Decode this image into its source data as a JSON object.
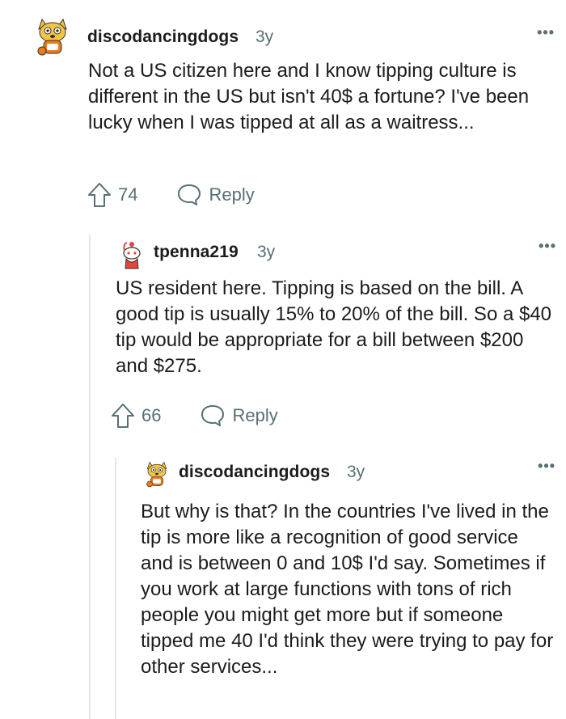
{
  "comments": [
    {
      "username": "discodancingdogs",
      "age": "3y",
      "more": "•••",
      "body": "Not a US citizen here and I know tipping culture is different in the US but isn't 40$ a fortune? I've been lucky when I was tipped at all as a waitress...",
      "votes": "74",
      "reply_label": "Reply"
    },
    {
      "username": "tpenna219",
      "age": "3y",
      "more": "•••",
      "body": "US resident here. Tipping is based on the bill. A good tip is usually 15% to 20% of the bill. So a $40 tip would be appropriate for a bill between $200 and $275.",
      "votes": "66",
      "reply_label": "Reply"
    },
    {
      "username": "discodancingdogs",
      "age": "3y",
      "more": "•••",
      "body": "But why is that? In the countries I've lived in the tip is more like a recognition of good service and is between 0 and 10$ I'd say. Sometimes if you work at large functions with tons of rich people you might get more but if someone tipped me 40 I'd think they were trying to pay for other services..."
    }
  ],
  "colors": {
    "text": "#1c1c1c",
    "meta": "#576f76",
    "thread_line": "#e4e6e8"
  }
}
